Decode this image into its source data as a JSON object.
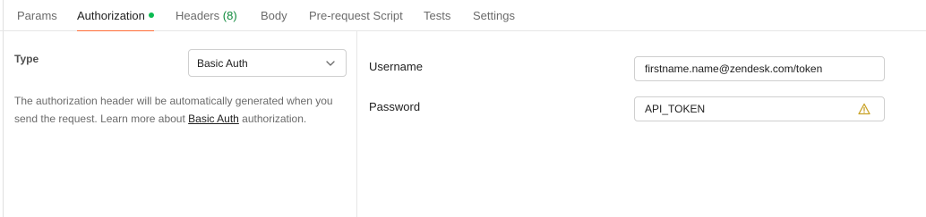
{
  "tabs": [
    {
      "label": "Params"
    },
    {
      "label": "Authorization"
    },
    {
      "label": "Headers",
      "count": "(8)"
    },
    {
      "label": "Body"
    },
    {
      "label": "Pre-request Script"
    },
    {
      "label": "Tests"
    },
    {
      "label": "Settings"
    }
  ],
  "active_tab": "Authorization",
  "auth": {
    "type_label": "Type",
    "type_value": "Basic Auth",
    "description_before": "The authorization header will be automatically generated when you send the request. Learn more about ",
    "description_link": "Basic Auth",
    "description_after": " authorization."
  },
  "fields": {
    "username_label": "Username",
    "username_value": "firstname.name@zendesk.com/token",
    "password_label": "Password",
    "password_value": "API_TOKEN"
  },
  "colors": {
    "accent": "#ff6c37",
    "status_dot": "#0cbb52",
    "count_text": "#0f8a3c",
    "warning": "#c9a227"
  },
  "icons": {
    "select_chevron": "chevron-down-icon",
    "password_warning": "warning-triangle-icon"
  }
}
